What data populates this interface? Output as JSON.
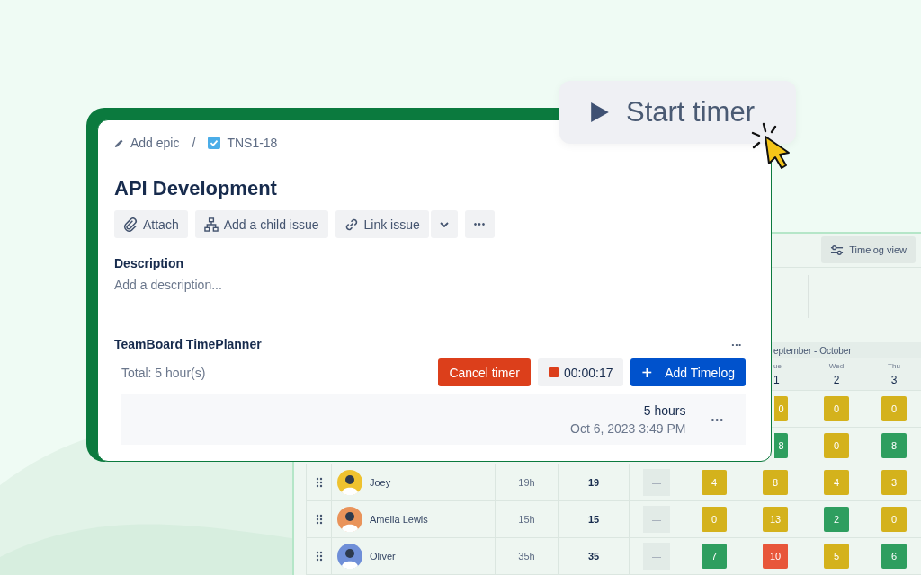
{
  "start_timer_button": {
    "label": "Start timer"
  },
  "timesheet": {
    "toolbar": {
      "view_button": "Timelog view"
    },
    "month_header": "eptember - October",
    "day_headers": [
      {
        "day": "ue",
        "date": "1"
      },
      {
        "day": "Wed",
        "date": "2"
      },
      {
        "day": "Thu",
        "date": "3"
      }
    ],
    "rows": [
      {
        "kind": "partial",
        "days": [
          {
            "value": "0",
            "color": "#d4b21c"
          },
          {
            "value": "0",
            "color": "#d4b21c"
          },
          {
            "value": "0",
            "color": "#d4b21c"
          }
        ]
      },
      {
        "kind": "partial",
        "days": [
          {
            "value": "8",
            "color": "#2e9e5f"
          },
          {
            "value": "0",
            "color": "#d4b21c"
          },
          {
            "value": "8",
            "color": "#2e9e5f"
          }
        ]
      },
      {
        "kind": "member",
        "name": "Joey",
        "hours": "19h",
        "total": "19",
        "column_6": "—",
        "days": [
          {
            "value": "4",
            "color": "#d4b21c"
          },
          {
            "value": "8",
            "color": "#d4b21c"
          },
          {
            "value": "4",
            "color": "#d4b21c"
          },
          {
            "value": "3",
            "color": "#d4b21c"
          }
        ]
      },
      {
        "kind": "member",
        "name": "Amelia Lewis",
        "hours": "15h",
        "total": "15",
        "column_6": "—",
        "days": [
          {
            "value": "0",
            "color": "#d4b21c"
          },
          {
            "value": "13",
            "color": "#d4b21c"
          },
          {
            "value": "2",
            "color": "#2e9e5f"
          },
          {
            "value": "0",
            "color": "#d4b21c"
          }
        ]
      },
      {
        "kind": "member",
        "name": "Oliver",
        "hours": "35h",
        "total": "35",
        "column_6": "—",
        "days": [
          {
            "value": "7",
            "color": "#2e9e5f"
          },
          {
            "value": "10",
            "color": "#e8563a"
          },
          {
            "value": "5",
            "color": "#d4b21c"
          },
          {
            "value": "6",
            "color": "#2e9e5f"
          }
        ]
      }
    ]
  },
  "issue": {
    "breadcrumb": {
      "epic": "Add epic",
      "separator": "/",
      "key": "TNS1-18"
    },
    "title": "API Development",
    "actions": [
      "Attach",
      "Add a child issue",
      "Link issue"
    ],
    "more": "•••",
    "description": {
      "label": "Description",
      "placeholder": "Add a description..."
    },
    "timeplanner": {
      "title": "TeamBoard TimePlanner",
      "more": "•••",
      "total": "Total: 5 hour(s)",
      "cancel_button": "Cancel timer",
      "timer": "00:00:17",
      "add_button": "Add Timelog",
      "add_icon": "+",
      "entries": [
        {
          "hours": "5 hours",
          "date": "Oct 6, 2023 3:49 PM",
          "more": "•••"
        }
      ]
    }
  }
}
